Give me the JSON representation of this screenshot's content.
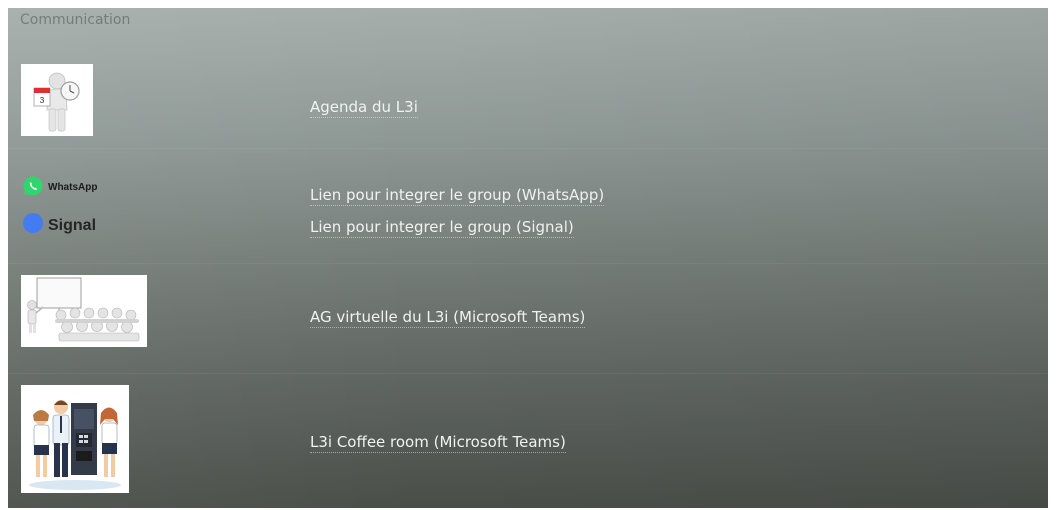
{
  "section": {
    "title": "Communication"
  },
  "rows": {
    "agenda": {
      "link": "Agenda du L3i"
    },
    "groups": {
      "whatsapp_logo_text": "WhatsApp",
      "signal_logo_text": "Signal",
      "whatsapp_link": "Lien pour integrer le group (WhatsApp)",
      "signal_link": "Lien pour integrer le group (Signal)"
    },
    "ag": {
      "link": "AG virtuelle du L3i (Microsoft Teams)"
    },
    "coffee": {
      "link": "L3i Coffee room (Microsoft Teams)"
    }
  },
  "colors": {
    "whatsapp_green": "#25d366",
    "signal_blue": "#3a76f0",
    "link_text": "#f0f3f1"
  },
  "icons": [
    "calendar-clock-figure-image",
    "whatsapp-logo-icon",
    "signal-logo-icon",
    "presentation-audience-image",
    "coffee-machine-people-image"
  ]
}
